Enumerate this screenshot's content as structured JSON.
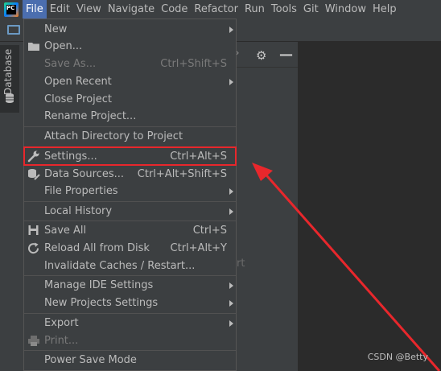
{
  "app": {
    "icon_text": "PC"
  },
  "menubar": {
    "items": [
      {
        "label": "File",
        "active": true
      },
      {
        "label": "Edit"
      },
      {
        "label": "View"
      },
      {
        "label": "Navigate"
      },
      {
        "label": "Code"
      },
      {
        "label": "Refactor"
      },
      {
        "label": "Run"
      },
      {
        "label": "Tools"
      },
      {
        "label": "Git"
      },
      {
        "label": "Window"
      },
      {
        "label": "Help"
      }
    ]
  },
  "side": {
    "tab_label": "Database"
  },
  "background": {
    "ghost_text": "rt"
  },
  "file_menu": {
    "new": "New",
    "open": "Open...",
    "save_as": "Save As...",
    "save_as_shortcut": "Ctrl+Shift+S",
    "open_recent": "Open Recent",
    "close_project": "Close Project",
    "rename_project": "Rename Project...",
    "attach_directory": "Attach Directory to Project",
    "settings": "Settings...",
    "settings_shortcut": "Ctrl+Alt+S",
    "data_sources": "Data Sources...",
    "data_sources_shortcut": "Ctrl+Alt+Shift+S",
    "file_properties": "File Properties",
    "local_history": "Local History",
    "save_all": "Save All",
    "save_all_shortcut": "Ctrl+S",
    "reload_all": "Reload All from Disk",
    "reload_all_shortcut": "Ctrl+Alt+Y",
    "invalidate_caches": "Invalidate Caches / Restart...",
    "manage_ide_settings": "Manage IDE Settings",
    "new_projects_settings": "New Projects Settings",
    "export": "Export",
    "print": "Print...",
    "power_save": "Power Save Mode"
  },
  "colors": {
    "highlight": "#e8272c",
    "menu_active": "#4b6eaf"
  },
  "watermark": "CSDN @Betty"
}
